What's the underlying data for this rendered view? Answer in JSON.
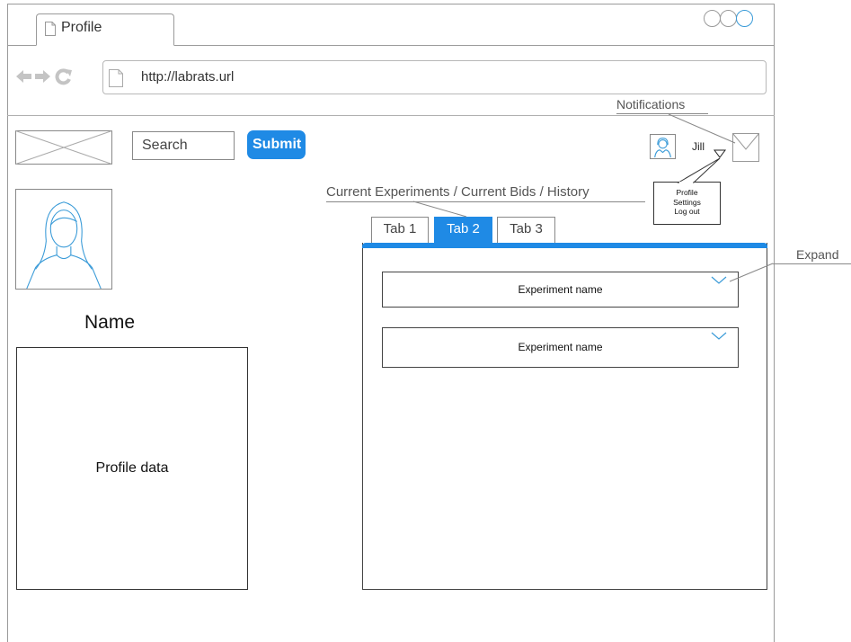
{
  "browser": {
    "tab_title": "Profile",
    "url": "http://labrats.url"
  },
  "toolbar": {
    "search_placeholder": "Search",
    "submit_label": "Submit",
    "user_name": "Jill"
  },
  "annotations": {
    "notifications": "Notifications",
    "section_title": "Current Experiments / Current Bids / History",
    "expand": "Expand"
  },
  "profile_menu": {
    "items": [
      "Profile",
      "Settings",
      "Log out"
    ]
  },
  "profile": {
    "name": "Name",
    "data_label": "Profile data"
  },
  "tabs": [
    {
      "label": "Tab 1",
      "active": false
    },
    {
      "label": "Tab 2",
      "active": true
    },
    {
      "label": "Tab 3",
      "active": false
    }
  ],
  "experiments": [
    {
      "name": "Experiment name"
    },
    {
      "name": "Experiment name"
    }
  ],
  "colors": {
    "accent": "#1f8ae5",
    "sketch_blue": "#3a9bd8",
    "border": "#9a9a9a"
  },
  "icons": [
    "page-icon",
    "back-arrow-icon",
    "forward-arrow-icon",
    "reload-icon",
    "mail-icon",
    "user-avatar-icon",
    "chevron-down-icon",
    "logo-placeholder-icon"
  ]
}
